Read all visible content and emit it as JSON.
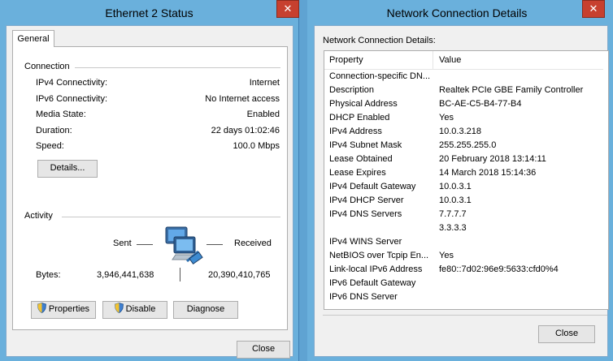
{
  "status_window": {
    "title": "Ethernet 2 Status",
    "tab": "General",
    "connection": {
      "heading": "Connection",
      "rows": [
        {
          "label": "IPv4 Connectivity:",
          "value": "Internet"
        },
        {
          "label": "IPv6 Connectivity:",
          "value": "No Internet access"
        },
        {
          "label": "Media State:",
          "value": "Enabled"
        },
        {
          "label": "Duration:",
          "value": "22 days 01:02:46"
        },
        {
          "label": "Speed:",
          "value": "100.0 Mbps"
        }
      ],
      "details_button": "Details..."
    },
    "activity": {
      "heading": "Activity",
      "sent_label": "Sent",
      "received_label": "Received",
      "bytes_label": "Bytes:",
      "bytes_sent": "3,946,441,638",
      "bytes_received": "20,390,410,765"
    },
    "buttons": {
      "properties": "Properties",
      "disable": "Disable",
      "diagnose": "Diagnose",
      "close": "Close"
    }
  },
  "details_window": {
    "title": "Network Connection Details",
    "section_label": "Network Connection Details:",
    "columns": {
      "property": "Property",
      "value": "Value"
    },
    "rows": [
      {
        "property": "Connection-specific DN...",
        "value": ""
      },
      {
        "property": "Description",
        "value": "Realtek PCIe GBE Family Controller"
      },
      {
        "property": "Physical Address",
        "value": "BC-AE-C5-B4-77-B4"
      },
      {
        "property": "DHCP Enabled",
        "value": "Yes"
      },
      {
        "property": "IPv4 Address",
        "value": "10.0.3.218"
      },
      {
        "property": "IPv4 Subnet Mask",
        "value": "255.255.255.0"
      },
      {
        "property": "Lease Obtained",
        "value": "20 February 2018 13:14:11"
      },
      {
        "property": "Lease Expires",
        "value": "14 March 2018 15:14:36"
      },
      {
        "property": "IPv4 Default Gateway",
        "value": "10.0.3.1"
      },
      {
        "property": "IPv4 DHCP Server",
        "value": "10.0.3.1"
      },
      {
        "property": "IPv4 DNS Servers",
        "value": "7.7.7.7"
      },
      {
        "property": "",
        "value": "3.3.3.3"
      },
      {
        "property": "IPv4 WINS Server",
        "value": ""
      },
      {
        "property": "NetBIOS over Tcpip En...",
        "value": "Yes"
      },
      {
        "property": "Link-local IPv6 Address",
        "value": "fe80::7d02:96e9:5633:cfd0%4"
      },
      {
        "property": "IPv6 Default Gateway",
        "value": ""
      },
      {
        "property": "IPv6 DNS Server",
        "value": ""
      }
    ],
    "close_button": "Close"
  },
  "icons": {
    "window_close": "close-icon",
    "uac": "uac-shield-icon",
    "network": "network-computers-icon"
  },
  "colors": {
    "window_frame": "#6ab0dc",
    "close_button": "#c7402f",
    "dialog_face": "#f0f0f0"
  }
}
